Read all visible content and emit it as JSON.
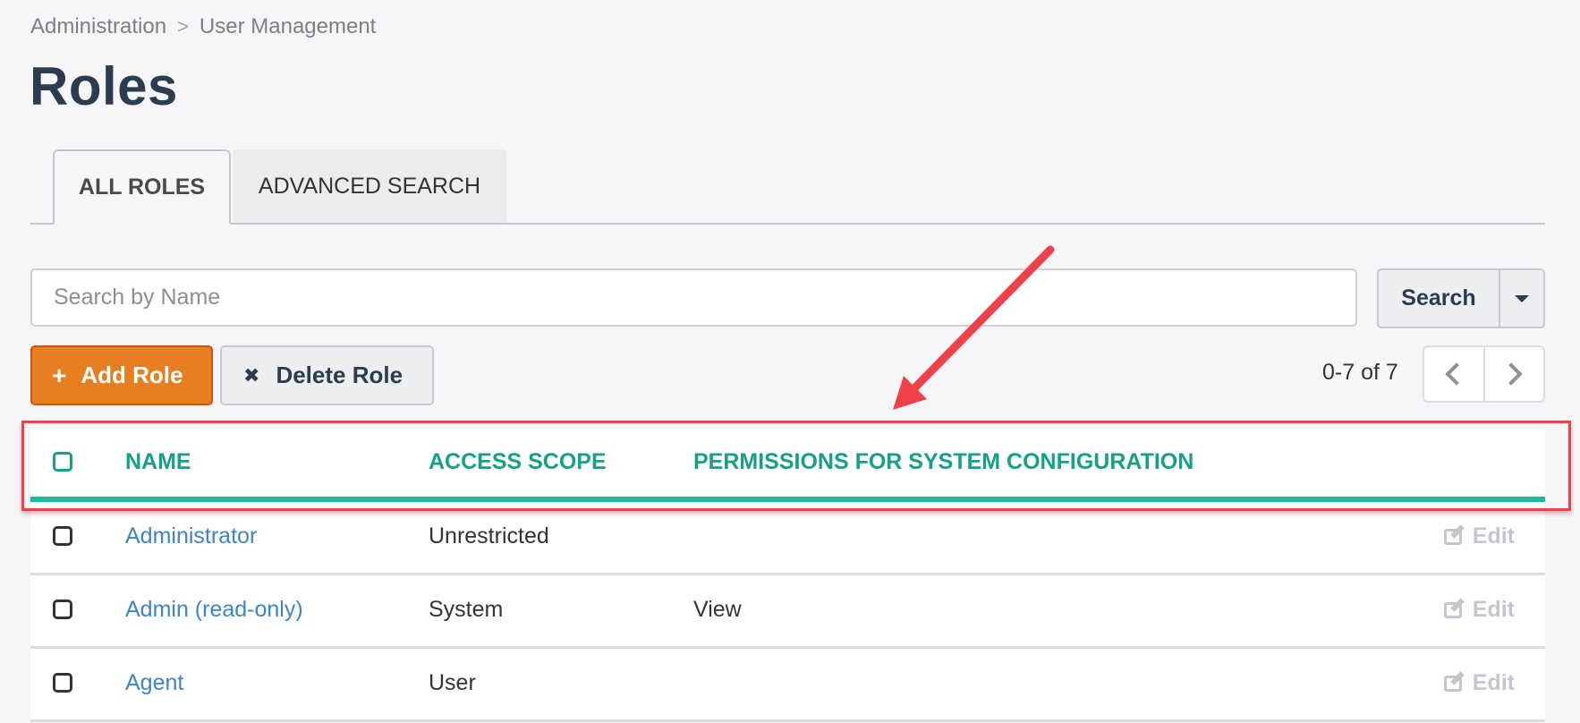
{
  "breadcrumb": {
    "items": [
      "Administration",
      "User Management"
    ],
    "separator": ">"
  },
  "page": {
    "title": "Roles"
  },
  "tabs": [
    {
      "label": "ALL ROLES",
      "active": true
    },
    {
      "label": "ADVANCED SEARCH",
      "active": false
    }
  ],
  "search": {
    "placeholder": "Search by Name",
    "value": "",
    "button_label": "Search"
  },
  "toolbar": {
    "add_label": "Add Role",
    "add_icon": "+",
    "delete_label": "Delete Role",
    "delete_icon": "✖"
  },
  "pagination": {
    "text": "0-7 of 7"
  },
  "table": {
    "columns": [
      "NAME",
      "ACCESS SCOPE",
      "PERMISSIONS FOR SYSTEM CONFIGURATION"
    ],
    "rows": [
      {
        "name": "Administrator",
        "scope": "Unrestricted",
        "permissions": "",
        "action": "Edit"
      },
      {
        "name": "Admin (read-only)",
        "scope": "System",
        "permissions": "View",
        "action": "Edit"
      },
      {
        "name": "Agent",
        "scope": "User",
        "permissions": "",
        "action": "Edit"
      }
    ]
  },
  "colors": {
    "accent_teal": "#1abc9c",
    "header_text": "#16a085",
    "add_button": "#e67e22",
    "link": "#3d85c6",
    "annotation": "#f0414a"
  }
}
